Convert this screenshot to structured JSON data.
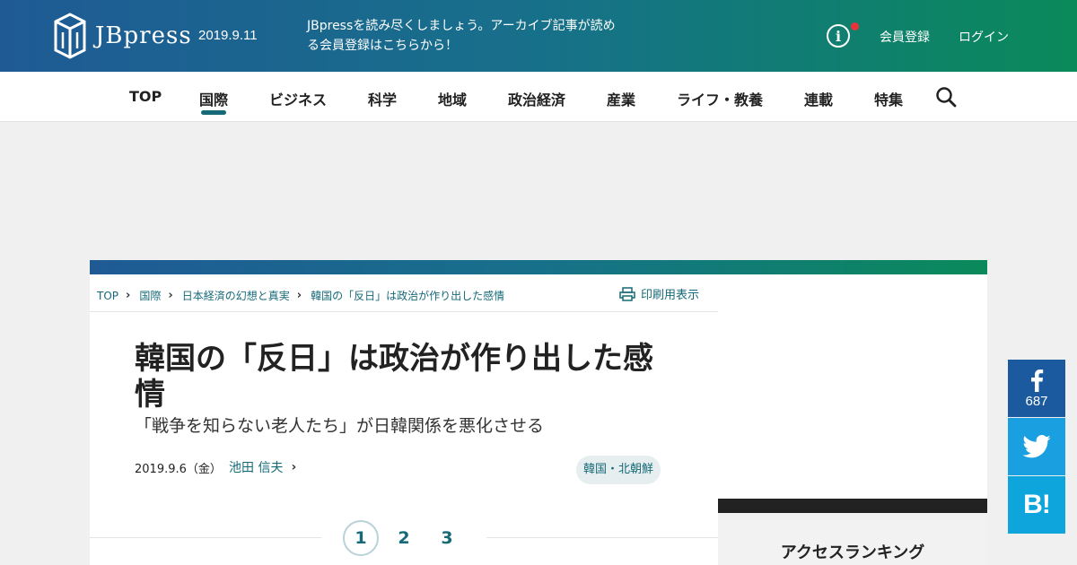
{
  "header": {
    "logo_text": "JBpress",
    "date": "2019.9.11",
    "promo_line1": "JBpressを読み尽くしましょう。アーカイブ記事が読め",
    "promo_line2": "る会員登録はこちらから！",
    "register_label": "会員登録",
    "login_label": "ログイン"
  },
  "nav": {
    "items": [
      "TOP",
      "国際",
      "ビジネス",
      "科学",
      "地域",
      "政治経済",
      "産業",
      "ライフ・教養",
      "連載",
      "特集"
    ],
    "active": "国際"
  },
  "breadcrumb": [
    "TOP",
    "国際",
    "日本経済の幻想と真実",
    "韓国の「反日」は政治が作り出した感情"
  ],
  "print_label": "印刷用表示",
  "article": {
    "title_line1": "韓国の「反日」は政治が作り出した感",
    "title_line2": "情",
    "subtitle": "「戦争を知らない老人たち」が日韓関係を悪化させる",
    "date": "2019.9.6（金）",
    "author": "池田 信夫",
    "tag": "韓国・北朝鮮"
  },
  "pager": {
    "pages": [
      "1",
      "2",
      "3"
    ],
    "current": "1"
  },
  "sidebar": {
    "ranking_title": "アクセスランキング"
  },
  "social": {
    "facebook_count": "687",
    "hatena_label": "B!"
  },
  "colors": {
    "accent": "#166a78",
    "header_start": "#1f5a95",
    "header_end": "#0a8a5a",
    "facebook": "#1b5a9e",
    "twitter": "#1a9fe0",
    "hatena": "#0ea5dc"
  }
}
